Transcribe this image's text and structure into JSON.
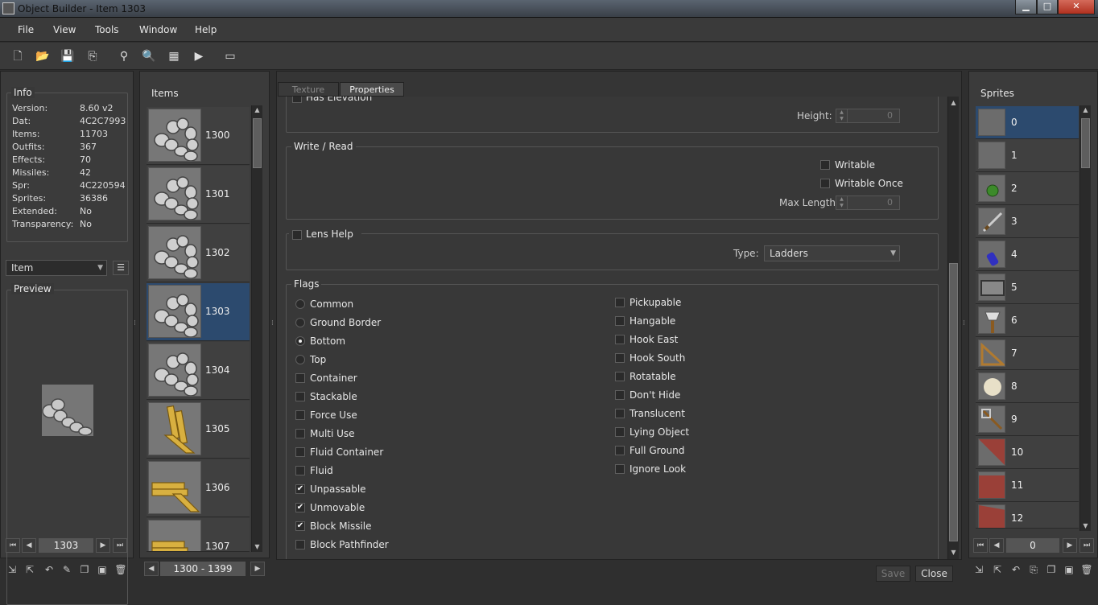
{
  "window": {
    "title": "Object Builder - Item 1303",
    "min": "▁",
    "max": "□",
    "close": "✕"
  },
  "menu": [
    "File",
    "View",
    "Tools",
    "Window",
    "Help"
  ],
  "info": {
    "title": "Info",
    "rows": [
      {
        "label": "Version:",
        "value": "8.60 v2"
      },
      {
        "label": "Dat:",
        "value": "4C2C7993"
      },
      {
        "label": "Items:",
        "value": "11703"
      },
      {
        "label": "Outfits:",
        "value": "367"
      },
      {
        "label": "Effects:",
        "value": "70"
      },
      {
        "label": "Missiles:",
        "value": "42"
      },
      {
        "label": "Spr:",
        "value": "4C220594"
      },
      {
        "label": "Sprites:",
        "value": "36386"
      },
      {
        "label": "Extended:",
        "value": "No"
      },
      {
        "label": "Transparency:",
        "value": "No"
      }
    ]
  },
  "category_select": {
    "value": "Item"
  },
  "preview": {
    "title": "Preview"
  },
  "left_nav": {
    "value": "1303"
  },
  "items": {
    "title": "Items",
    "list": [
      {
        "id": "1300"
      },
      {
        "id": "1301"
      },
      {
        "id": "1302"
      },
      {
        "id": "1303"
      },
      {
        "id": "1304"
      },
      {
        "id": "1305"
      },
      {
        "id": "1306"
      },
      {
        "id": "1307"
      }
    ],
    "selected": "1303",
    "range": "1300 - 1399"
  },
  "tabs": {
    "texture": "Texture",
    "properties": "Properties"
  },
  "elevation": {
    "label": "Has Elevation",
    "height_label": "Height:",
    "height_value": "0"
  },
  "write_read": {
    "title": "Write / Read",
    "writable": "Writable",
    "writable_once": "Writable Once",
    "max_length_label": "Max Length",
    "max_length_value": "0"
  },
  "lens_help": {
    "label": "Lens Help",
    "type_label": "Type:",
    "type_value": "Ladders"
  },
  "flags": {
    "title": "Flags",
    "left": [
      {
        "label": "Common",
        "kind": "radio",
        "checked": false
      },
      {
        "label": "Ground Border",
        "kind": "radio",
        "checked": false
      },
      {
        "label": "Bottom",
        "kind": "radio",
        "checked": true
      },
      {
        "label": "Top",
        "kind": "radio",
        "checked": false
      },
      {
        "label": "Container",
        "kind": "check",
        "checked": false
      },
      {
        "label": "Stackable",
        "kind": "check",
        "checked": false
      },
      {
        "label": "Force Use",
        "kind": "check",
        "checked": false
      },
      {
        "label": "Multi Use",
        "kind": "check",
        "checked": false
      },
      {
        "label": "Fluid Container",
        "kind": "check",
        "checked": false
      },
      {
        "label": "Fluid",
        "kind": "check",
        "checked": false
      },
      {
        "label": "Unpassable",
        "kind": "check",
        "checked": true
      },
      {
        "label": "Unmovable",
        "kind": "check",
        "checked": true
      },
      {
        "label": "Block Missile",
        "kind": "check",
        "checked": true
      },
      {
        "label": "Block Pathfinder",
        "kind": "check",
        "checked": false
      }
    ],
    "right": [
      {
        "label": "Pickupable",
        "checked": false
      },
      {
        "label": "Hangable",
        "checked": false
      },
      {
        "label": "Hook East",
        "checked": false
      },
      {
        "label": "Hook South",
        "checked": false
      },
      {
        "label": "Rotatable",
        "checked": false
      },
      {
        "label": "Don't Hide",
        "checked": false
      },
      {
        "label": "Translucent",
        "checked": false
      },
      {
        "label": "Lying Object",
        "checked": false
      },
      {
        "label": "Full Ground",
        "checked": false
      },
      {
        "label": "Ignore Look",
        "checked": false
      }
    ]
  },
  "actions": {
    "save": "Save",
    "close": "Close"
  },
  "sprites": {
    "title": "Sprites",
    "list": [
      "0",
      "1",
      "2",
      "3",
      "4",
      "5",
      "6",
      "7",
      "8",
      "9",
      "10",
      "11",
      "12"
    ],
    "selected": "0",
    "nav_value": "0"
  },
  "check_mark": "✔"
}
